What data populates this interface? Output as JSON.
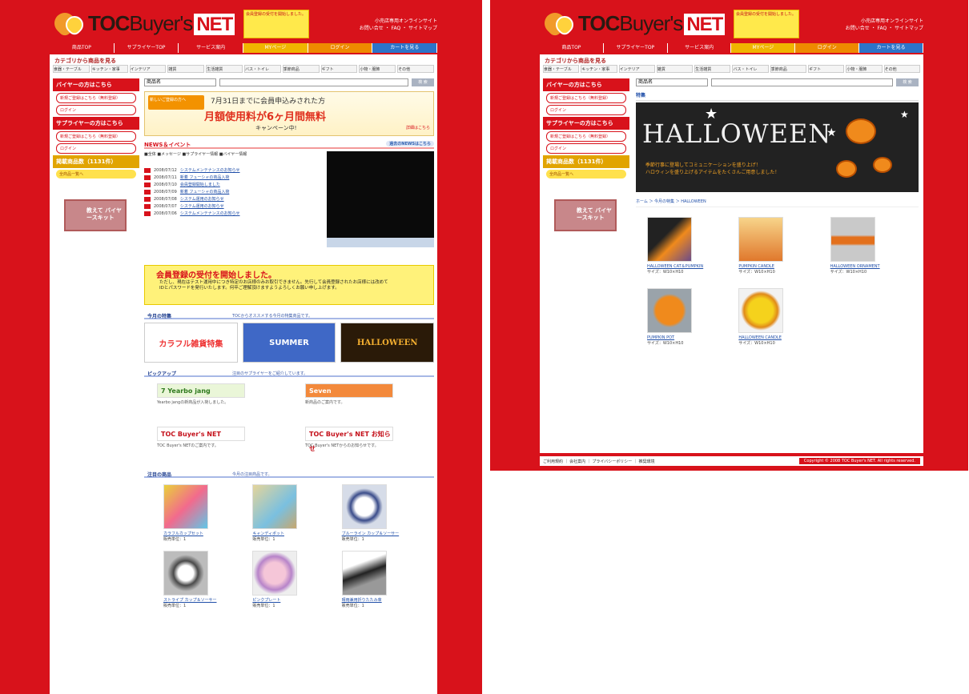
{
  "brand": {
    "logo_main": "TOC",
    "logo_sub": "Buyer's",
    "logo_net": "NET",
    "notice": "会員登録の受付を開始しました。",
    "tagline_1": "小売店専用オンラインサイト",
    "tagline_2": "お問い合せ ・ FAQ ・ サイトマップ"
  },
  "nav": {
    "items": [
      "商品TOP",
      "サプライヤーTOP",
      "サービス案内",
      "MYページ",
      "ログイン",
      "カートを見る"
    ]
  },
  "categories": {
    "title": "カテゴリから商品を見る",
    "items": [
      "食器・テーブル",
      "キッチン・家事",
      "インテリア",
      "雑貨",
      "生活雑貨",
      "バス・トイレ",
      "季節商品",
      "ギフト",
      "小物・服飾",
      "その他"
    ]
  },
  "sidebar": {
    "buyer_head": "バイヤーの方はこちら",
    "buyer_btn1": "新規ご登録はこちら（無料登録）",
    "buyer_btn2": "ログイン",
    "supplier_head": "サプライヤーの方はこちら",
    "supplier_btn1": "新規ご登録はこちら（無料登録）",
    "supplier_btn2": "ログイン",
    "count_head": "掲載商品数（1131件）",
    "count_btn": "全商品一覧へ",
    "mascot": "教えて バイヤースキット"
  },
  "search": {
    "select": "商品名",
    "button": "検 索"
  },
  "campaign": {
    "tag": "新しいご登録の方へ",
    "line1": "7月31日までに会員申込みされた方",
    "line2": "月額使用料が6ヶ月間無料",
    "line3": "キャンペーン中!",
    "link": "詳細はこちら"
  },
  "news": {
    "title": "NEWS＆イベント",
    "more": "過去のNEWSはこちら",
    "legend": "■全体 ■メッセージ ■サプライヤー情報 ■バイヤー情報",
    "items": [
      {
        "date": "2008/07/12",
        "text": "システムメンテナンスのお知らせ"
      },
      {
        "date": "2008/07/11",
        "text": "新着 フューシャの商品入荷"
      },
      {
        "date": "2008/07/10",
        "text": "会員登録開始しました"
      },
      {
        "date": "2008/07/09",
        "text": "新着 フューシャの商品入荷"
      },
      {
        "date": "2008/07/08",
        "text": "システム運用のお知らせ"
      },
      {
        "date": "2008/07/07",
        "text": "システム運用のお知らせ"
      },
      {
        "date": "2008/07/06",
        "text": "システムメンテナンスのお知らせ"
      }
    ]
  },
  "registration": {
    "title": "会員登録の受付を開始しました。",
    "body": "ただし、現在はテスト運用中につき特定のお店様のみお取引できません。先行して会員登録されたお店様には改めてIDとパスワードを発行いたします。何卒ご理解頂けますようよろしくお願い申し上げます。"
  },
  "feature": {
    "label": "今月の特集",
    "desc": "TOCからオススメする今月の特集商品です。",
    "banners": [
      "カラフル雑貨特集",
      "SUMMER",
      "HALLOWEEN"
    ]
  },
  "pickup": {
    "label": "ピックアップ",
    "desc": "注目のサプライヤーをご紹介しています。",
    "items": [
      {
        "logo": "7 Yearbo jang",
        "text": "Yearbo jangの新商品が入荷しました。"
      },
      {
        "logo": "Seven",
        "text": "新商品のご案内です。"
      },
      {
        "logo": "TOC Buyer's NET",
        "text": "TOC Buyer's NETのご案内です。"
      },
      {
        "logo": "TOC Buyer's NET お知らせ",
        "text": "TOC Buyer's NETからのお知らせです。"
      }
    ]
  },
  "products_left": {
    "label": "注目の商品",
    "desc": "今月の注目商品です。",
    "items": [
      {
        "name": "カラフルカップセット",
        "meta": "販売単位：1"
      },
      {
        "name": "キャンディポット",
        "meta": "販売単位：1"
      },
      {
        "name": "ブルーライン カップ＆ソーサー",
        "meta": "販売単位：1"
      },
      {
        "name": "ストライプ カップ＆ソーサー",
        "meta": "販売単位：1"
      },
      {
        "name": "ピンクプレート",
        "meta": "販売単位：1"
      },
      {
        "name": "晴雨兼用折りたたみ傘",
        "meta": "販売単位：1"
      }
    ]
  },
  "right_page": {
    "feature_label": "特集",
    "hw_title": "HALLOWEEN",
    "hw_sub_1": "季節行事に登場してコミュニケーションを盛り上げ！",
    "hw_sub_2": "ハロウィンを盛り上げるアイテムをたくさんご用意しました！",
    "crumb": "ホーム ＞ 今月の特集 ＞ HALLOWEEN",
    "products": [
      {
        "name": "HALLOWEEN CAT＆PUMPKIN",
        "meta": "サイズ：W10×H10"
      },
      {
        "name": "PUMPKIN CANDLE",
        "meta": "サイズ：W10×H10"
      },
      {
        "name": "HALLOWEEN ORNAMENT",
        "meta": "サイズ：W10×H10"
      },
      {
        "name": "PUMPKIN POT",
        "meta": "サイズ：W10×H10"
      },
      {
        "name": "HALLOWEEN CANDLE",
        "meta": "サイズ：W10×H10"
      }
    ],
    "footer_left": "ご利用規約 ｜ 会社案内 ｜ プライバシーポリシー ｜ 推奨環境",
    "footer_right": "Copyright © 2008 TOC Buyer's NET. All rights reserved."
  },
  "colors": {
    "brand_red": "#d8121b",
    "accent_yellow": "#fff27a",
    "link_blue": "#1f4ea8"
  }
}
